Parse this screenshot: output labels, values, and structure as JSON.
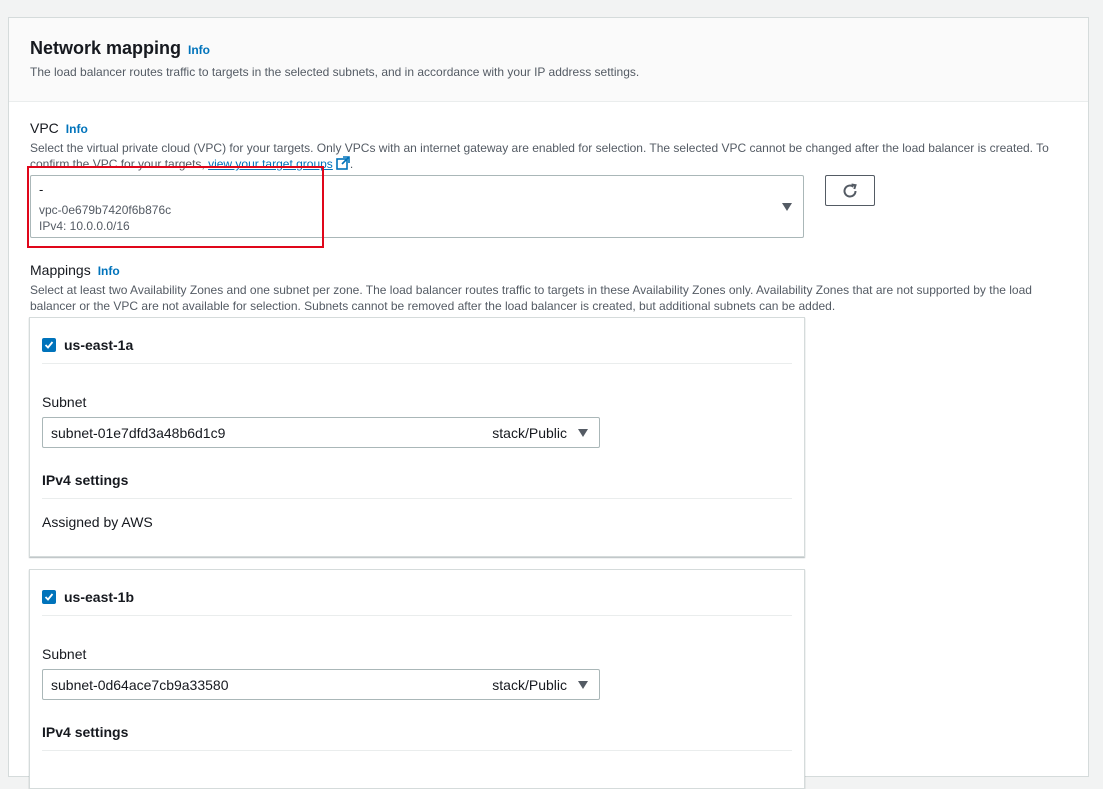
{
  "section": {
    "title": "Network mapping",
    "info": "Info",
    "description": "The load balancer routes traffic to targets in the selected subnets, and in accordance with your IP address settings."
  },
  "vpc": {
    "label": "VPC",
    "info": "Info",
    "description_before_link": "Select the virtual private cloud (VPC) for your targets. Only VPCs with an internet gateway are enabled for selection. The selected VPC cannot be changed after the load balancer is created. To confirm the VPC for your targets, ",
    "link_text": "view your target groups",
    "description_after_link": ".",
    "selected_name": "-",
    "selected_id": "vpc-0e679b7420f6b876c",
    "selected_cidr": "IPv4: 10.0.0.0/16",
    "icons": {
      "dropdown": "caret-down-icon",
      "refresh": "refresh-icon",
      "external": "external-link-icon"
    }
  },
  "mappings": {
    "label": "Mappings",
    "info": "Info",
    "description": "Select at least two Availability Zones and one subnet per zone. The load balancer routes traffic to targets in these Availability Zones only. Availability Zones that are not supported by the load balancer or the VPC are not available for selection. Subnets cannot be removed after the load balancer is created, but additional subnets can be added.",
    "zones": [
      {
        "name": "us-east-1a",
        "checked": true,
        "subnet_label": "Subnet",
        "subnet_id": "subnet-01e7dfd3a48b6d1c9",
        "subnet_name": "stack/Public",
        "ipv4_title": "IPv4 settings",
        "ipv4_value": "Assigned by AWS"
      },
      {
        "name": "us-east-1b",
        "checked": true,
        "subnet_label": "Subnet",
        "subnet_id": "subnet-0d64ace7cb9a33580",
        "subnet_name": "stack/Public",
        "ipv4_title": "IPv4 settings"
      }
    ]
  },
  "colors": {
    "link": "#0073bb",
    "highlight": "#e0061a",
    "page_bg": "#f2f3f3",
    "checkbox": "#0073bb"
  }
}
